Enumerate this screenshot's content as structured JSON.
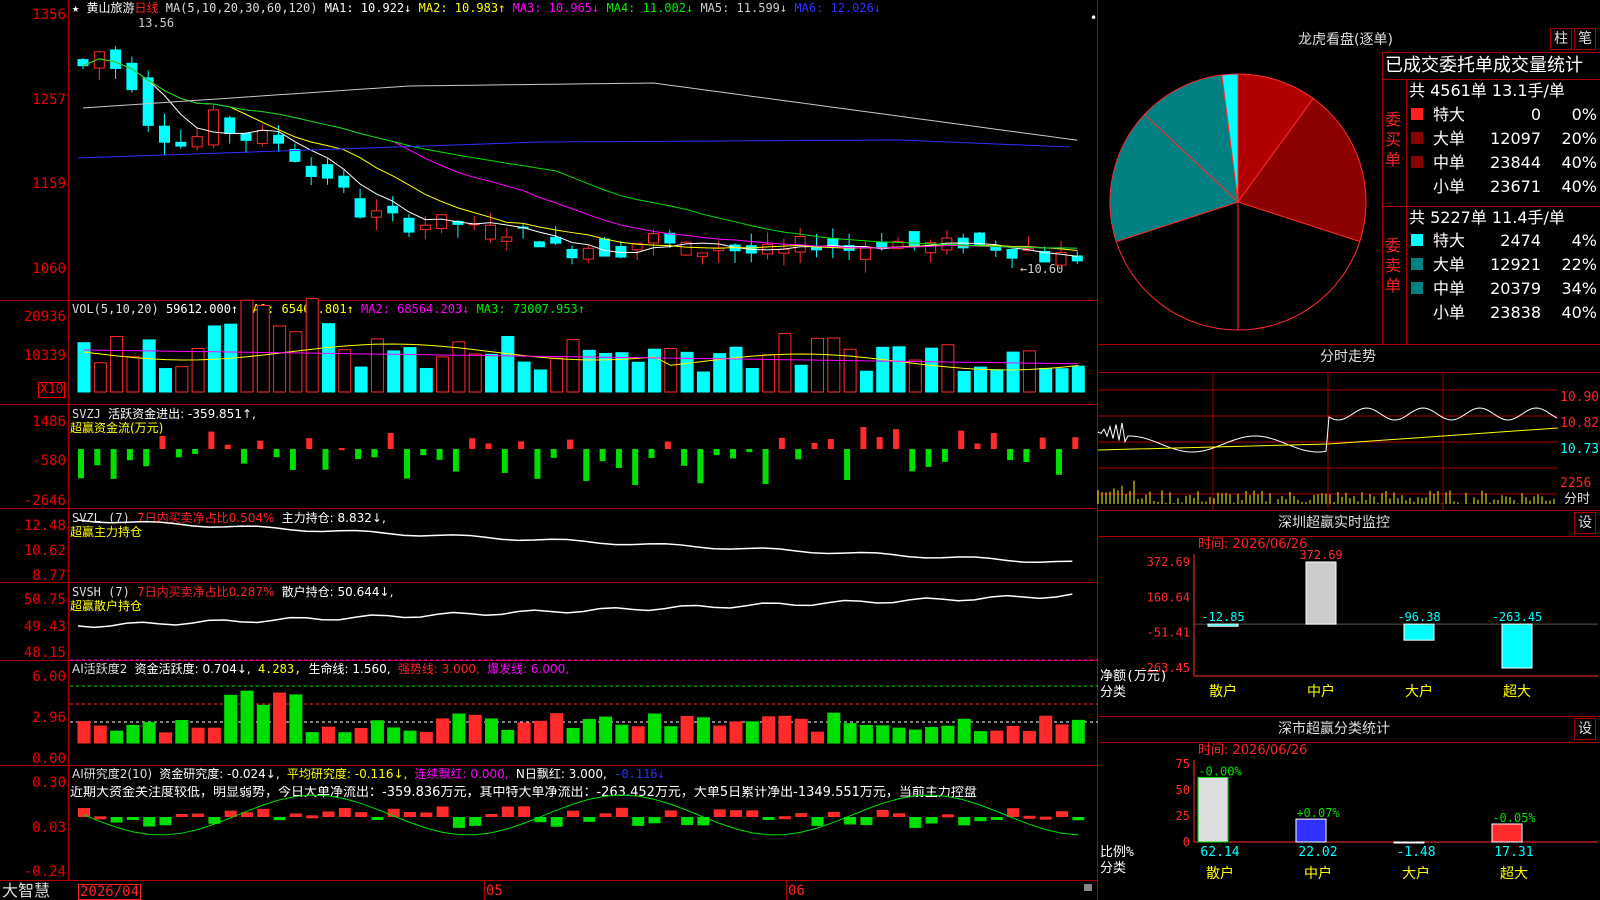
{
  "colors": {
    "up": "#ff2b2b",
    "down": "#00ffff",
    "grid": "#a00000",
    "yellow": "#ffff00",
    "magenta": "#ff00ff",
    "green": "#00e000",
    "white": "#ffffff",
    "blue": "#3030ff",
    "gray": "#c8c8c8",
    "teal": "#008080",
    "darkred": "#8b0000",
    "darkred2": "#b00000"
  },
  "stock": {
    "star": "★",
    "name": "黄山旅游",
    "period": "日线",
    "high_mark": "13.56",
    "low_mark": "←10.60",
    "ma_title": "MA(5,10,20,30,60,120)",
    "ma": [
      "MA1: 10.922↓",
      "MA2: 10.983↑",
      "MA3: 10.965↓",
      "MA4: 11.002↓",
      "MA5: 11.599↓",
      "MA6: 12.026↓"
    ]
  },
  "price_axis": [
    "1356",
    "1257",
    "1159",
    "1060"
  ],
  "vol": {
    "title": "VOL(5,10,20)",
    "value": "59612.000↑",
    "ma": [
      "MA1: 65461.801↑",
      "MA2: 68564.203↓",
      "MA3: 73007.953↑"
    ],
    "axis": [
      "20936",
      "10339"
    ],
    "unit": "X10"
  },
  "svzj": {
    "title": "SVZJ",
    "label": "活跃资金进出: -359.851↑,",
    "sub": "超赢资金流(万元)",
    "axis": [
      "1486",
      "-580",
      "-2646"
    ]
  },
  "svzl": {
    "title": "SVZL (7)",
    "label": "7日内买卖净占比0.504%",
    "hold": "主力持仓: 8.832↓,",
    "sub": "超赢主力持仓",
    "axis": [
      "12.48",
      "10.62",
      "8.77"
    ]
  },
  "svsh": {
    "title": "SVSH (7)",
    "label": "7日内买卖净占比0.287%",
    "hold": "散户持仓: 50.644↓,",
    "sub": "超赢散户持仓",
    "axis": [
      "50.75",
      "49.43",
      "48.15"
    ]
  },
  "ai1": {
    "title": "AI活跃度2",
    "a": "资金活跃度: 0.704↓,",
    "b": "4.283,",
    "c": "生命线: 1.560,",
    "d": "强势线: 3.000,",
    "e": "爆发线: 6.000,",
    "axis": [
      "6.00",
      "2.96",
      "0.00"
    ]
  },
  "ai2": {
    "title": "AI研究度2(10)",
    "a": "资金研究度: -0.024↓,",
    "b": "平均研究度: -0.116↓,",
    "c": "连续飘红: 0.000,",
    "d": "N日飘红: 3.000,",
    "e": "-0.116↓",
    "note": "近期大资金关注度较低，明显弱势，今日大单净流出：-359.836万元，其中特大单净流出：-263.452万元，大单5日累计净出-1349.551万元，当前主力控盘",
    "axis": [
      "0.30",
      "0.03",
      "-0.24"
    ]
  },
  "bottom": {
    "brand": "大智慧",
    "date": "2026/04",
    "m05": "05",
    "m06": "06"
  },
  "right": {
    "longhu": {
      "title": "龙虎看盘(逐单)",
      "btn1": "柱",
      "btn2": "笔",
      "header": "已成交委托单成交量统计",
      "buy": {
        "label": "委买单",
        "total": "共 4561单 13.1手/单",
        "rows": [
          {
            "name": "特大",
            "vol": "0",
            "pct": "0%",
            "color": "#ff2020"
          },
          {
            "name": "大单",
            "vol": "12097",
            "pct": "20%",
            "color": "#8b0000"
          },
          {
            "name": "中单",
            "vol": "23844",
            "pct": "40%",
            "color": "#8b0000"
          },
          {
            "name": "小单",
            "vol": "23671",
            "pct": "40%",
            "color": ""
          }
        ]
      },
      "sell": {
        "label": "委卖单",
        "total": "共 5227单 11.4手/单",
        "rows": [
          {
            "name": "特大",
            "vol": "2474",
            "pct": "4%",
            "color": "#00ffff"
          },
          {
            "name": "大单",
            "vol": "12921",
            "pct": "22%",
            "color": "#008080"
          },
          {
            "name": "中单",
            "vol": "20379",
            "pct": "34%",
            "color": "#008080"
          },
          {
            "name": "小单",
            "vol": "23838",
            "pct": "40%",
            "color": ""
          }
        ]
      },
      "pie": [
        {
          "label": "buy-large",
          "pct": 20
        },
        {
          "label": "buy-mid",
          "pct": 40
        },
        {
          "label": "buy-small",
          "pct": 40
        },
        {
          "label": "sell-small",
          "pct": 40
        },
        {
          "label": "sell-mid",
          "pct": 34
        },
        {
          "label": "sell-large",
          "pct": 22
        },
        {
          "label": "sell-xl",
          "pct": 4
        }
      ]
    },
    "fenshi": {
      "title": "分时走势",
      "axis": [
        "10.90",
        "10.82",
        "10.73",
        "2256"
      ],
      "vol_label": "分时"
    },
    "sz_monitor": {
      "title": "深圳超赢实时监控",
      "btn": "设",
      "time": "时间: 2026/06/26",
      "axis": [
        "372.69",
        "160.64",
        "-51.41",
        "-263.45"
      ],
      "ylabel": "净额(万元)",
      "xlabel": "分类",
      "bars": [
        {
          "cat": "散户",
          "value": -12.85,
          "label": "-12.85"
        },
        {
          "cat": "中户",
          "value": 372.69,
          "label": "372.69"
        },
        {
          "cat": "大户",
          "value": -96.38,
          "label": "-96.38"
        },
        {
          "cat": "超大",
          "value": -263.45,
          "label": "-263.45"
        }
      ]
    },
    "sz_class": {
      "title": "深市超赢分类统计",
      "btn": "设",
      "time": "时间: 2026/06/26",
      "axis": [
        "75",
        "50",
        "25",
        "0"
      ],
      "ylabel": "比例%",
      "xlabel": "分类",
      "bars": [
        {
          "cat": "散户",
          "value": 62.14,
          "label": "62.14",
          "chg": "-0.00%"
        },
        {
          "cat": "中户",
          "value": 22.02,
          "label": "22.02",
          "chg": "+0.07%"
        },
        {
          "cat": "大户",
          "value": -1.48,
          "label": "-1.48",
          "chg": ""
        },
        {
          "cat": "超大",
          "value": 17.31,
          "label": "17.31",
          "chg": "-0.05%"
        }
      ]
    }
  }
}
